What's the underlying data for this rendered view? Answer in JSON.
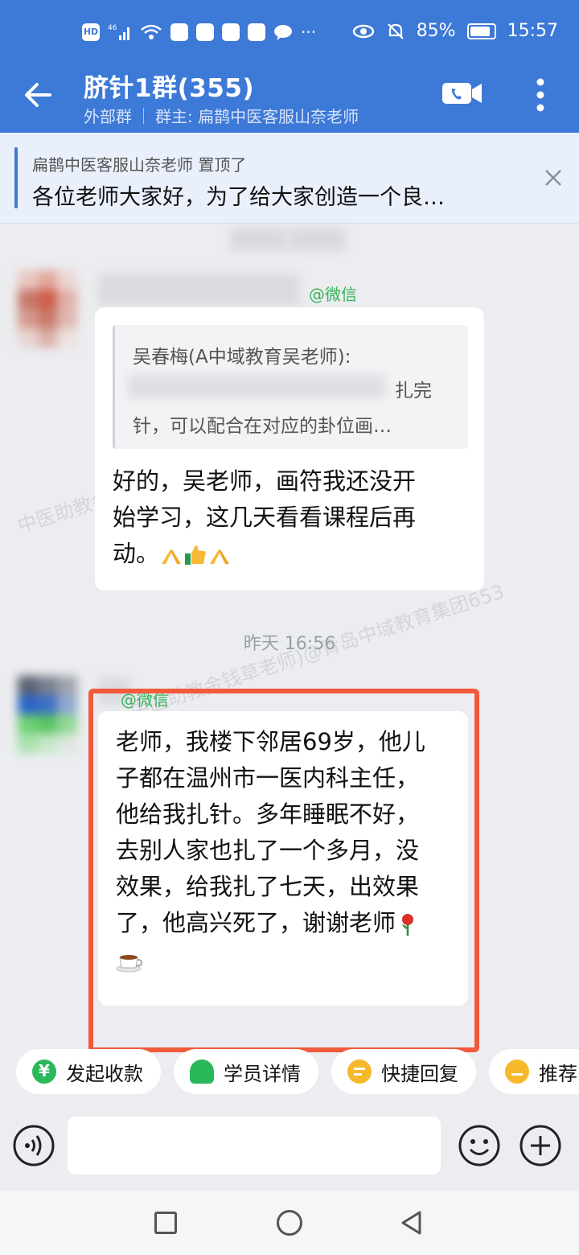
{
  "status_bar": {
    "network_badge": "HD",
    "signal": "46",
    "battery": "85%",
    "battery_level": 0.85,
    "time": "15:57"
  },
  "header": {
    "title": "脐针1群(355)",
    "group_type": "外部群",
    "owner": "群主: 扁鹊中医客服山奈老师"
  },
  "pinned": {
    "from": "扁鹊中医客服山奈老师 置顶了",
    "text": "各位老师大家好，为了给大家创造一个良…"
  },
  "messages": {
    "first": {
      "sender_suffix": "@微信",
      "quote_name": "吴春梅(A中域教育吴老师):",
      "quote_line2": "扎完",
      "quote_line3": "针，可以配合在对应的卦位画…",
      "lines": [
        "好的，吴老师，画符我还没开",
        "始学习，这几天看看课程后再",
        "动。"
      ],
      "emojis": [
        "folded-hands-icon",
        "thumbs-up-icon",
        "folded-hands-icon"
      ]
    },
    "timestamp": "昨天  16:56",
    "second": {
      "sender_suffix": "@微信",
      "lines": [
        "老师，我楼下邻居69岁，他儿",
        "子都在温州市一医内科主任，",
        "他给我扎针。多年睡眠不好，",
        "去别人家也扎了一个多月，没",
        "效果，给我扎了七天，出效果",
        "了，他高兴死了，谢谢老师"
      ],
      "emojis": [
        "rose-icon",
        "coffee-icon"
      ]
    }
  },
  "watermarks": [
    "中医助教金钱草老师)@青岛中域教育集团653",
    "中医助教金钱草老师)@青岛中域教育集团653"
  ],
  "quick_actions": [
    {
      "label": "发起收款",
      "icon": "payment-icon",
      "color": "#2bb85a"
    },
    {
      "label": "学员详情",
      "icon": "student-icon",
      "color": "#2bb85a"
    },
    {
      "label": "快捷回复",
      "icon": "quick-reply-icon",
      "color": "#f6b92b"
    },
    {
      "label": "推荐",
      "icon": "recommend-icon",
      "color": "#f6b92b"
    }
  ],
  "colors": {
    "header_bg": "#3d79d6",
    "highlight_border": "#f15a3c",
    "wechat_green": "#36b35a"
  }
}
